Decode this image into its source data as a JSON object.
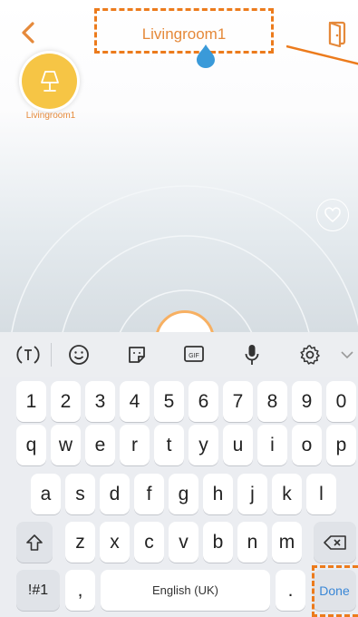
{
  "header": {
    "title": "Livingroom1"
  },
  "device": {
    "label": "Livingroom1"
  },
  "keyboard": {
    "row_numbers": [
      "1",
      "2",
      "3",
      "4",
      "5",
      "6",
      "7",
      "8",
      "9",
      "0"
    ],
    "row_1": [
      "q",
      "w",
      "e",
      "r",
      "t",
      "y",
      "u",
      "i",
      "o",
      "p"
    ],
    "row_2": [
      "a",
      "s",
      "d",
      "f",
      "g",
      "h",
      "j",
      "k",
      "l"
    ],
    "row_3": [
      "z",
      "x",
      "c",
      "v",
      "b",
      "n",
      "m"
    ],
    "symbols_label": "!#1",
    "comma": ",",
    "space_label": "English (UK)",
    "period": ".",
    "done_label": "Done",
    "gif_label": "GIF"
  },
  "colors": {
    "accent": "#e5893a",
    "callout": "#ec7b1c",
    "lamp": "#f6c545",
    "done": "#3a87d6"
  }
}
